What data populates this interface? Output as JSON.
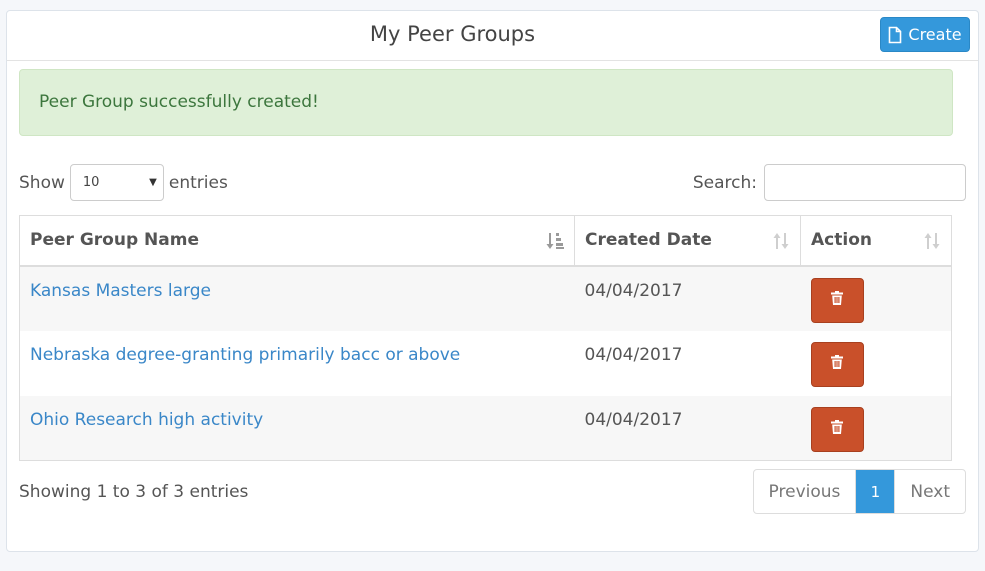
{
  "header": {
    "title": "My Peer Groups",
    "create_label": "Create"
  },
  "alert": {
    "message": "Peer Group successfully created!",
    "color": "#dff0d8"
  },
  "length": {
    "show_label": "Show",
    "selected": "10",
    "entries_label": "entries"
  },
  "search": {
    "label": "Search:",
    "value": ""
  },
  "table": {
    "columns": [
      "Peer Group Name",
      "Created Date",
      "Action"
    ],
    "rows": [
      {
        "name": "Kansas Masters large",
        "date": "04/04/2017"
      },
      {
        "name": "Nebraska degree-granting primarily bacc or above",
        "date": "04/04/2017"
      },
      {
        "name": "Ohio Research high activity",
        "date": "04/04/2017"
      }
    ]
  },
  "footer": {
    "info": "Showing 1 to 3 of 3 entries",
    "previous_label": "Previous",
    "current_page": "1",
    "next_label": "Next"
  },
  "colors": {
    "accent": "#3498db",
    "delete": "#c9502a",
    "link": "#3a87c8"
  }
}
